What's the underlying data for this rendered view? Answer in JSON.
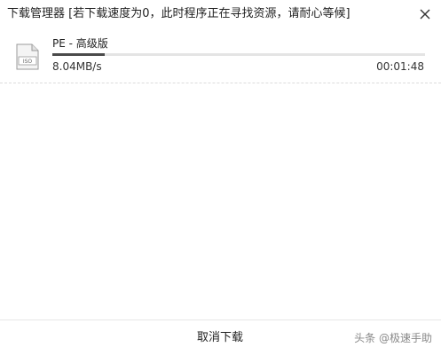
{
  "window": {
    "title": "下载管理器 [若下载速度为0，此时程序正在寻找资源，请耐心等候]",
    "close_icon": "close-icon"
  },
  "download": {
    "file_icon": "iso-file-icon",
    "file_icon_label": "ISO",
    "file_name": "PE - 高级版",
    "progress_fraction": 0.14,
    "speed": "8.04MB/s",
    "elapsed_time": "00:01:48"
  },
  "footer": {
    "cancel_label": "取消下载"
  },
  "watermark": {
    "text": "头条 @极速手助"
  },
  "colors": {
    "progress_fill": "#4a4a4a",
    "progress_track": "#e4e4e4",
    "divider": "#dcdcdc"
  }
}
